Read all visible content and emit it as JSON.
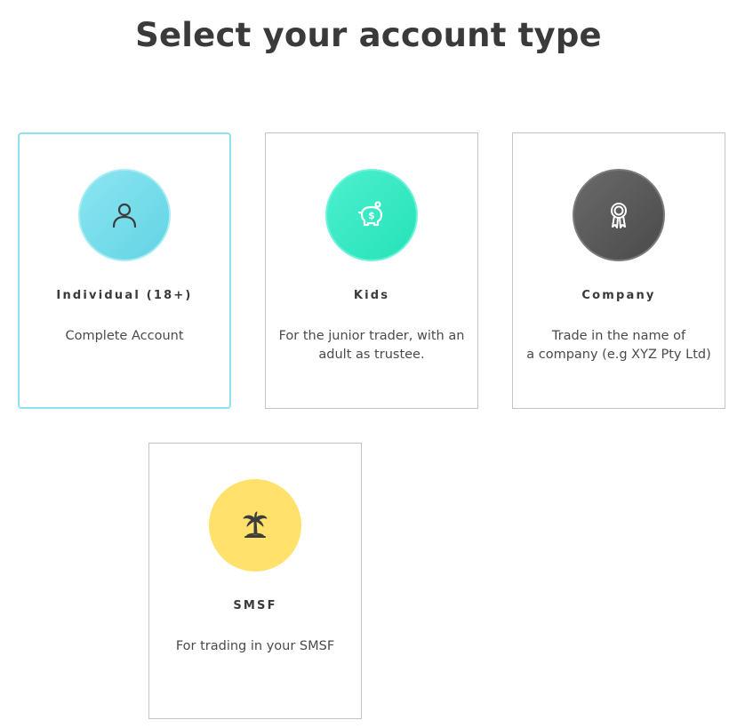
{
  "page": {
    "title": "Select your account type"
  },
  "cards": [
    {
      "id": "individual",
      "title": "Individual (18+)",
      "description": "Complete Account",
      "icon": "person-icon",
      "circle_color": "#75dde9",
      "selected": true
    },
    {
      "id": "kids",
      "title": "Kids",
      "description": "For the junior trader, with an adult as trustee.",
      "icon": "piggy-bank-icon",
      "circle_color": "#35ecc6",
      "selected": false
    },
    {
      "id": "company",
      "title": "Company",
      "description": "Trade in the name of\na company (e.g XYZ Pty Ltd)",
      "icon": "award-ribbon-icon",
      "circle_color": "#575757",
      "selected": false
    },
    {
      "id": "smsf",
      "title": "SMSF",
      "description": "For trading in your SMSF",
      "icon": "palm-tree-icon",
      "circle_color": "#ffe16b",
      "selected": false
    }
  ],
  "colors": {
    "selected_border": "#8fe3ea",
    "card_border": "#c4c4c4",
    "text": "#3a3a3a"
  }
}
